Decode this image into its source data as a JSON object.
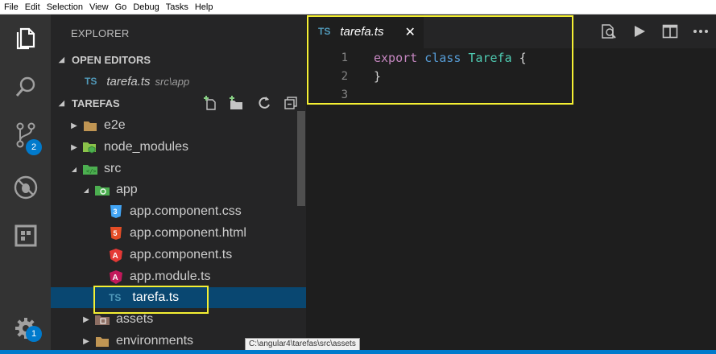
{
  "menubar": {
    "items": [
      "File",
      "Edit",
      "Selection",
      "View",
      "Go",
      "Debug",
      "Tasks",
      "Help"
    ]
  },
  "activitybar": {
    "icons": [
      "files-icon",
      "search-icon",
      "source-control-icon",
      "debug-icon",
      "extensions-icon",
      "gear-icon"
    ],
    "scm_badge": "2",
    "settings_badge": "1"
  },
  "sidebar": {
    "title": "EXPLORER",
    "open_editors": {
      "header": "OPEN EDITORS",
      "items": [
        {
          "icon": "TS",
          "name": "tarefa.ts",
          "path": "src\\app"
        }
      ]
    },
    "project": {
      "header": "TAREFAS",
      "tree": [
        {
          "name": "e2e",
          "twisty": "▶",
          "icon": "folder-icon"
        },
        {
          "name": "node_modules",
          "twisty": "▶",
          "icon": "node-folder-icon"
        },
        {
          "name": "src",
          "twisty": "◢",
          "icon": "src-folder-icon"
        },
        {
          "name": "app",
          "twisty": "◢",
          "icon": "app-folder-icon"
        },
        {
          "name": "app.component.css",
          "icon": "css-icon"
        },
        {
          "name": "app.component.html",
          "icon": "html-icon"
        },
        {
          "name": "app.component.ts",
          "icon": "angular-icon"
        },
        {
          "name": "app.module.ts",
          "icon": "angular-module-icon"
        },
        {
          "name": "tarefa.ts",
          "icon": "TS"
        },
        {
          "name": "assets",
          "twisty": "▶",
          "icon": "assets-folder-icon"
        },
        {
          "name": "environments",
          "twisty": "▶",
          "icon": "folder-icon"
        }
      ]
    }
  },
  "editor": {
    "tab": {
      "icon": "TS",
      "label": "tarefa.ts",
      "close": "✕"
    },
    "lines": [
      {
        "num": "1",
        "tokens": [
          {
            "t": "export",
            "c": "kw"
          },
          {
            "t": " ",
            "c": "pn"
          },
          {
            "t": "class",
            "c": "kw2"
          },
          {
            "t": " ",
            "c": "pn"
          },
          {
            "t": "Tarefa",
            "c": "cls"
          },
          {
            "t": " {",
            "c": "pn"
          }
        ]
      },
      {
        "num": "2",
        "tokens": [
          {
            "t": "}",
            "c": "pn"
          }
        ]
      },
      {
        "num": "3",
        "tokens": []
      }
    ]
  },
  "tooltip": "C:\\angular4\\tarefas\\src\\assets",
  "colors": {
    "highlight": "#f5f033",
    "selection": "#094771",
    "accent": "#007acc"
  }
}
